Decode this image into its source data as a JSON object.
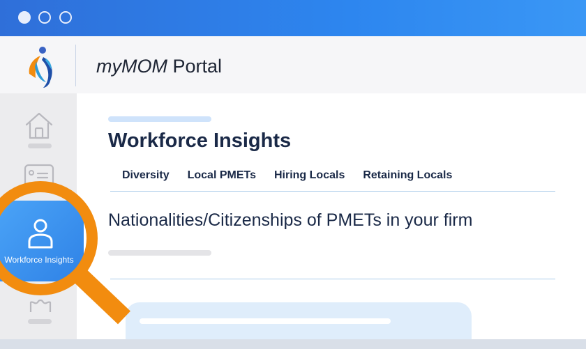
{
  "window": {
    "controls": [
      "close-dot",
      "minimize-dot",
      "maximize-dot"
    ]
  },
  "header": {
    "brand": "myMOM",
    "suffix": "Portal"
  },
  "sidebar": {
    "items": [
      {
        "icon": "home-icon"
      },
      {
        "icon": "id-card-icon"
      },
      {
        "icon": "person-icon",
        "label": "Workforce Insights",
        "active": true
      },
      {
        "icon": "puzzle-icon"
      }
    ]
  },
  "main": {
    "title": "Workforce Insights",
    "tabs": [
      {
        "label": "Diversity"
      },
      {
        "label": "Local PMETs"
      },
      {
        "label": "Hiring Locals"
      },
      {
        "label": "Retaining Locals"
      }
    ],
    "section_heading": "Nationalities/Citizenships of PMETs in your firm"
  },
  "overlay": {
    "icon": "magnifying-glass-icon"
  },
  "colors": {
    "title_bar": "#2d86ef",
    "active_tile": "#3b93f0",
    "magnifier": "#f28c0f",
    "heading_text": "#1a2947"
  }
}
